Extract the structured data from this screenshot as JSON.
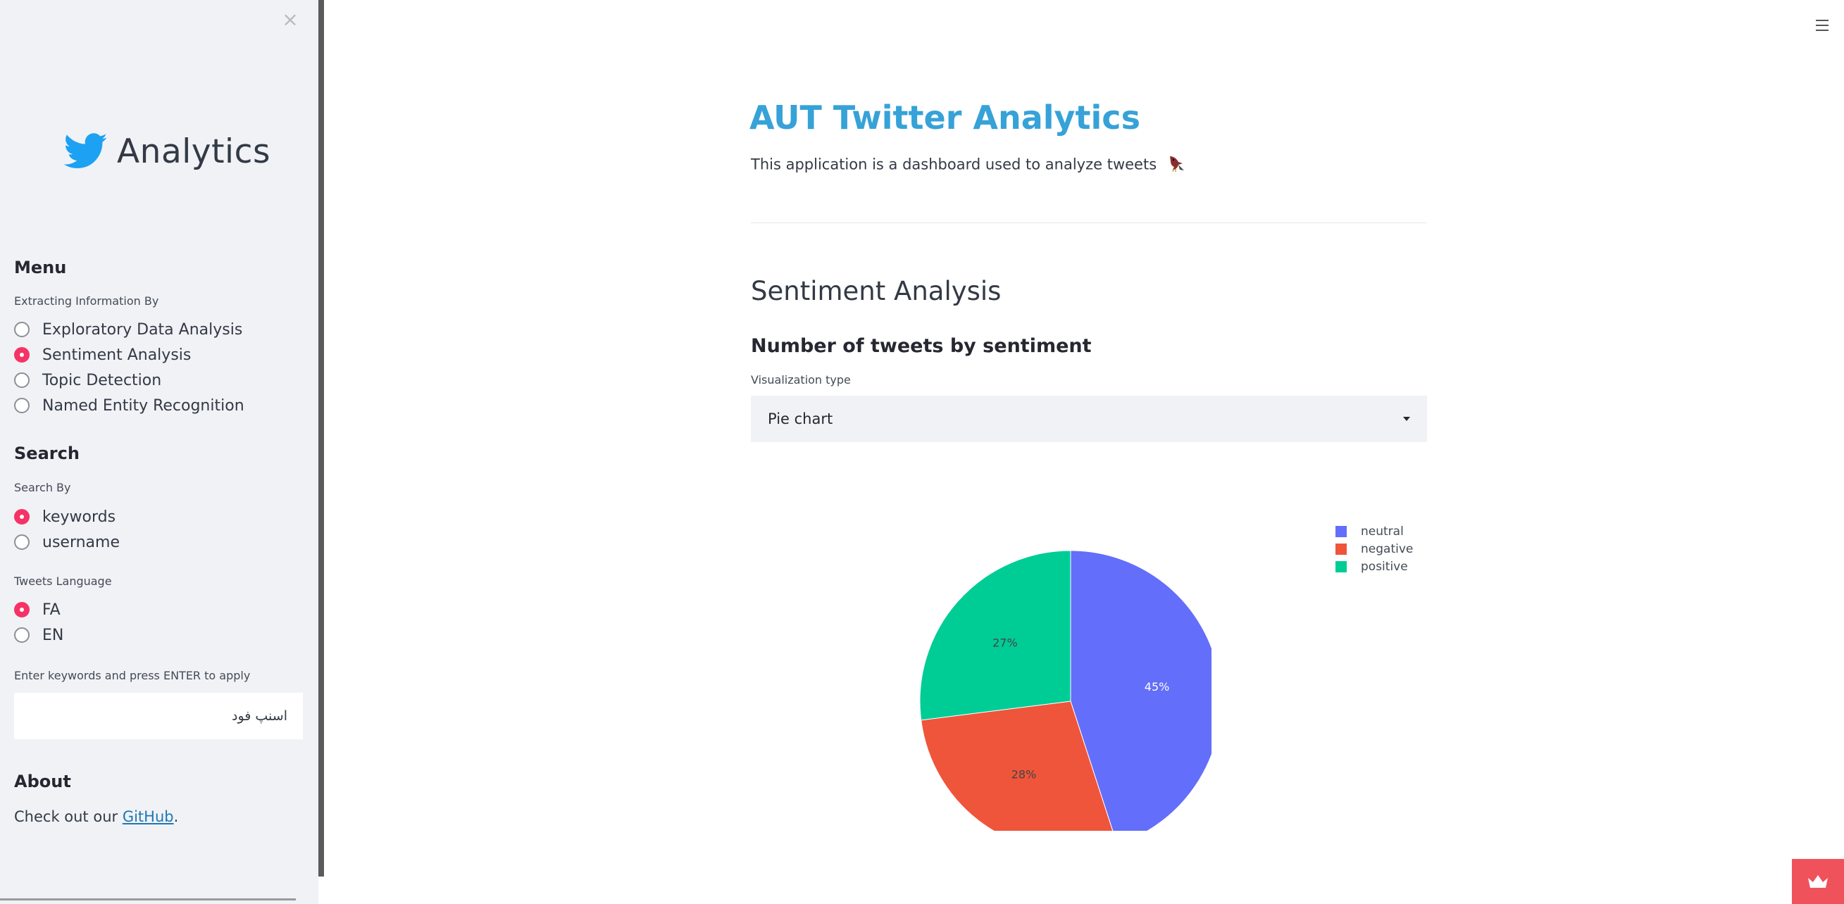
{
  "sidebar": {
    "close_icon": "×",
    "logo_text": "Analytics",
    "menu_heading": "Menu",
    "extract_label": "Extracting Information By",
    "extract_options": [
      {
        "label": "Exploratory Data Analysis",
        "checked": false
      },
      {
        "label": "Sentiment Analysis",
        "checked": true
      },
      {
        "label": "Topic Detection",
        "checked": false
      },
      {
        "label": "Named Entity Recognition",
        "checked": false
      }
    ],
    "search_heading": "Search",
    "search_by_label": "Search By",
    "search_by_options": [
      {
        "label": "keywords",
        "checked": true
      },
      {
        "label": "username",
        "checked": false
      }
    ],
    "lang_label": "Tweets Language",
    "lang_options": [
      {
        "label": "FA",
        "checked": true
      },
      {
        "label": "EN",
        "checked": false
      }
    ],
    "keywords_label": "Enter keywords and press ENTER to apply",
    "keywords_value": "اسنپ فود",
    "about_heading": "About",
    "about_text_prefix": "Check out our ",
    "about_link": "GitHub",
    "about_text_suffix": "."
  },
  "main": {
    "title": "AUT Twitter Analytics",
    "subtitle": "This application is a dashboard used to analyze tweets",
    "section_title": "Sentiment Analysis",
    "chart_heading": "Number of tweets by sentiment",
    "vis_label": "Visualization type",
    "vis_value": "Pie chart"
  },
  "colors": {
    "accent": "#f63366",
    "title": "#36a2d8",
    "neutral": "#636efa",
    "negative": "#ef553b",
    "positive": "#00cc96"
  },
  "icons": {
    "logo": "twitter-bird-icon",
    "menu": "hamburger-icon",
    "badge": "streamlit-crown-icon"
  },
  "chart_data": {
    "type": "pie",
    "labels": [
      "neutral",
      "negative",
      "positive"
    ],
    "values": [
      45,
      28,
      27
    ],
    "value_labels": [
      "45%",
      "28%",
      "27%"
    ],
    "colors": [
      "#636efa",
      "#ef553b",
      "#00cc96"
    ],
    "legend_position": "top-right"
  }
}
